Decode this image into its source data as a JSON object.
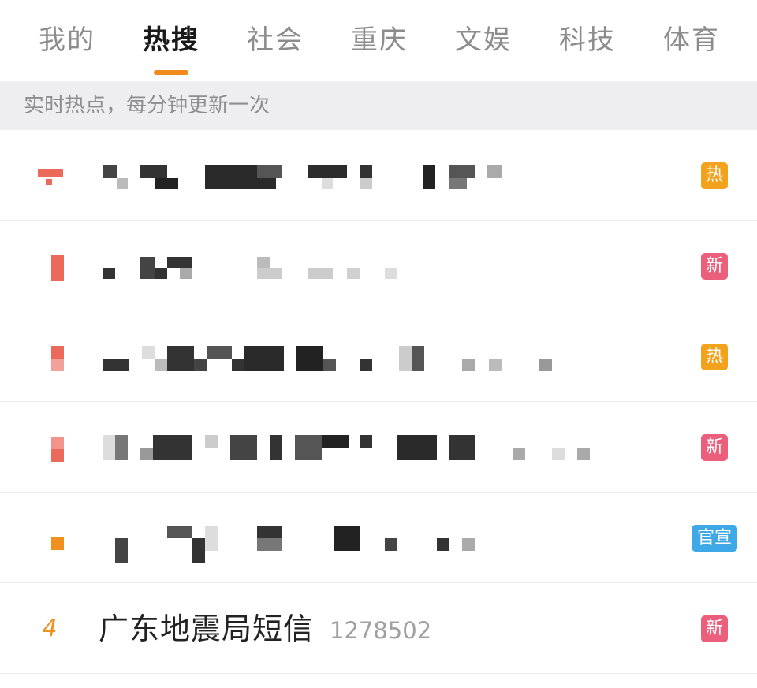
{
  "tabs": [
    {
      "label": "我的",
      "active": false
    },
    {
      "label": "热搜",
      "active": true
    },
    {
      "label": "社会",
      "active": false
    },
    {
      "label": "重庆",
      "active": false
    },
    {
      "label": "文娱",
      "active": false
    },
    {
      "label": "科技",
      "active": false
    },
    {
      "label": "体育",
      "active": false
    }
  ],
  "notice": "实时热点，每分钟更新一次",
  "rows": [
    {
      "rank": "",
      "title": "",
      "count": "",
      "badge": "热",
      "badge_color": "#f2a21c"
    },
    {
      "rank": "",
      "title": "",
      "count": "",
      "badge": "新",
      "badge_color": "#ec5f7c"
    },
    {
      "rank": "",
      "title": "",
      "count": "",
      "badge": "热",
      "badge_color": "#f2a21c"
    },
    {
      "rank": "",
      "title": "",
      "count": "",
      "badge": "新",
      "badge_color": "#ec5f7c"
    },
    {
      "rank": "",
      "title": "",
      "count": "",
      "badge": "官宣",
      "badge_color": "#3fa9e8"
    },
    {
      "rank": "4",
      "title": "广东地震局短信",
      "count": "1278502",
      "badge": "新",
      "badge_color": "#ec5f7c"
    }
  ],
  "colors": {
    "accent": "#f28b1e",
    "rank_top": "#ec6a5a",
    "rank_other": "#f0901e"
  }
}
